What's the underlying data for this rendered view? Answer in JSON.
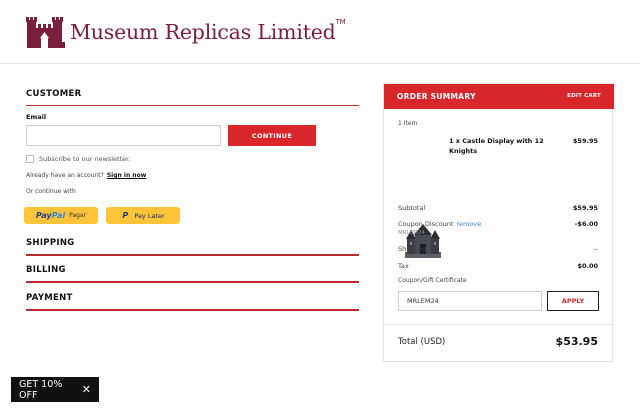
{
  "brand": {
    "name": "Museum Replicas Limited",
    "trademark": "TM",
    "logo_icon": "castle-logo-icon",
    "color": "#7a1f3b"
  },
  "checkout": {
    "customer": {
      "title": "CUSTOMER",
      "email_label": "Email",
      "email_value": "",
      "continue_label": "CONTINUE",
      "newsletter_label": "Subscribe to our newsletter.",
      "account_prompt": "Already have an account?",
      "signin_label": "Sign in now",
      "continue_with": "Or continue with",
      "paypal": {
        "word1": "Pay",
        "word2": "Pal",
        "suffix": "Pagar"
      },
      "paylater": {
        "label": "Pay Later"
      }
    },
    "sections": [
      {
        "title": "SHIPPING"
      },
      {
        "title": "BILLING"
      },
      {
        "title": "PAYMENT"
      }
    ]
  },
  "summary": {
    "title": "ORDER SUMMARY",
    "edit_cart": "EDIT CART",
    "item_count": "1 Item",
    "item": {
      "name": "1 x Castle Display with 12 Knights",
      "price": "$59.95"
    },
    "subtotal_label": "Subtotal",
    "subtotal_value": "$59.95",
    "discount_label": "Coupon Discount",
    "discount_remove": "remove",
    "discount_value": "-$6.00",
    "discount_code": "MRLEM24",
    "shipping_label": "Shipping",
    "shipping_value": "--",
    "tax_label": "Tax",
    "tax_value": "$0.00",
    "coupon_label": "Coupon/Gift Certificate",
    "coupon_value": "MRLEM24",
    "apply_label": "APPLY",
    "total_label": "Total (USD)",
    "total_value": "$53.95",
    "accent": "#d8262b"
  },
  "promo": {
    "label": "GET 10% OFF",
    "close_icon": "close-icon"
  }
}
